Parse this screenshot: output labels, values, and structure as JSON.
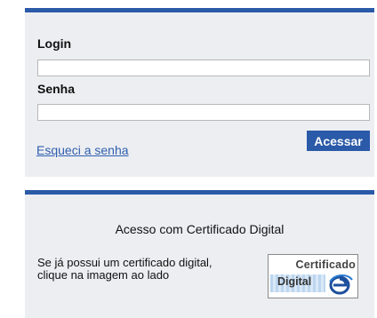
{
  "login_form": {
    "login_label": "Login",
    "login_value": "",
    "senha_label": "Senha",
    "senha_value": "",
    "submit_label": "Acessar",
    "forgot_link": "Esqueci a senha"
  },
  "certificate": {
    "title": "Acesso com Certificado Digital",
    "description_line1": "Se já possui um certificado digital,",
    "description_line2": "clique na imagem ao lado",
    "badge_line1": "Certificado",
    "badge_line2": "Digital",
    "badge_icon": "e-icon"
  },
  "colors": {
    "accent": "#2a5aa8",
    "panel_bg": "#edeef2",
    "link": "#2f5fae"
  }
}
